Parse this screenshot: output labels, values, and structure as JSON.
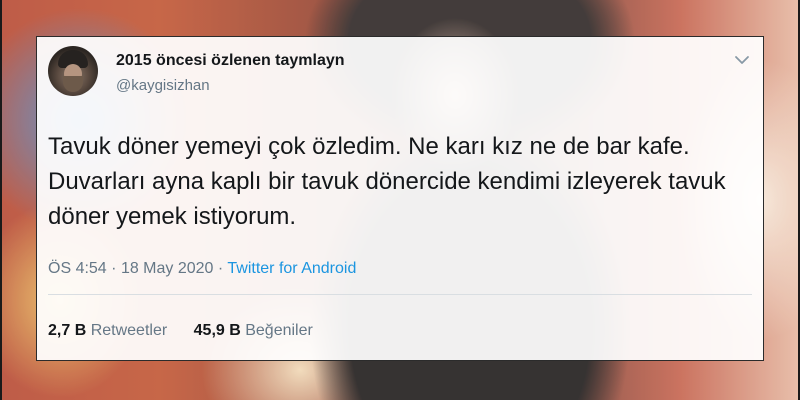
{
  "tweet": {
    "display_name": "2015 öncesi özlenen taymlayn",
    "handle": "@kaygisizhan",
    "text": "Tavuk döner yemeyi çok özledim. Ne karı kız ne de bar kafe. Duvarları ayna kaplı bir tavuk dönercide kendimi izleyerek tavuk döner yemek istiyorum.",
    "time": "ÖS 4:54",
    "separator": "·",
    "date": "18 May 2020",
    "source": "Twitter for Android",
    "retweets": {
      "count": "2,7 B",
      "label": "Retweetler"
    },
    "likes": {
      "count": "45,9 B",
      "label": "Beğeniler"
    },
    "menu_icon": "chevron-down-icon"
  },
  "colors": {
    "link": "#1b95e0",
    "text": "#14171a",
    "secondary": "#657786"
  }
}
